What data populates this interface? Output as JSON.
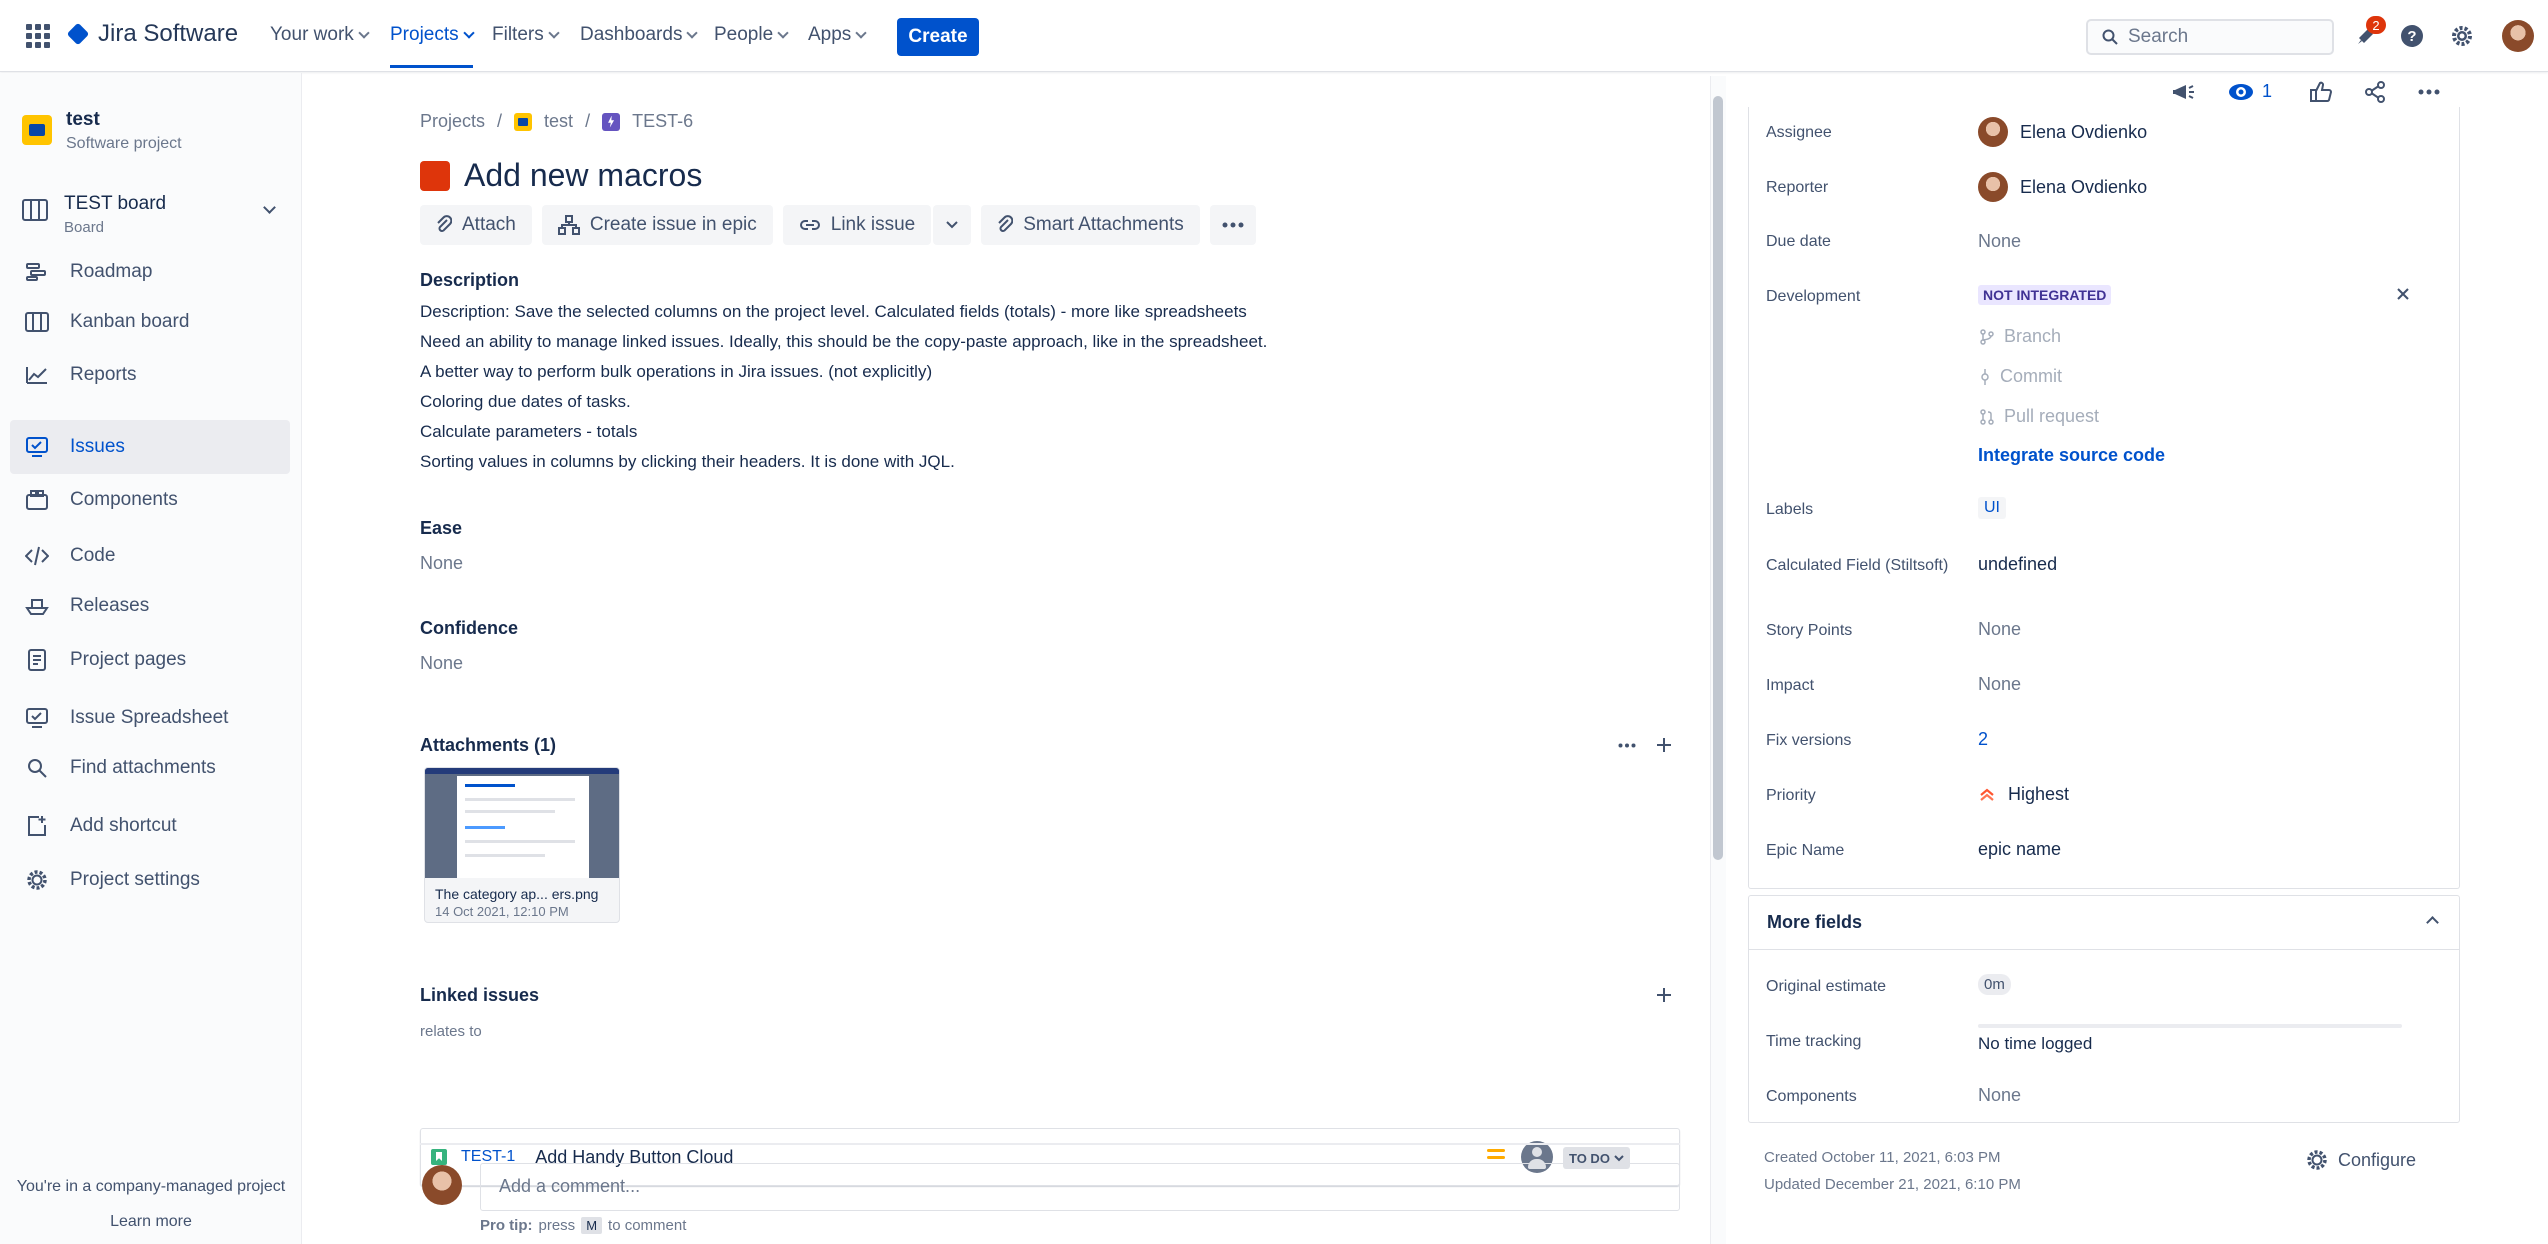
{
  "topnav": {
    "product": "Jira Software",
    "items": [
      {
        "label": "Your work"
      },
      {
        "label": "Projects"
      },
      {
        "label": "Filters"
      },
      {
        "label": "Dashboards"
      },
      {
        "label": "People"
      },
      {
        "label": "Apps"
      }
    ],
    "create_label": "Create",
    "search_placeholder": "Search",
    "notifications_count": "2"
  },
  "sidebar": {
    "project_name": "test",
    "project_type": "Software project",
    "board_name": "TEST board",
    "board_type": "Board",
    "items": [
      {
        "label": "Roadmap"
      },
      {
        "label": "Kanban board"
      },
      {
        "label": "Reports"
      },
      {
        "label": "Issues"
      },
      {
        "label": "Components"
      },
      {
        "label": "Code"
      },
      {
        "label": "Releases"
      },
      {
        "label": "Project pages"
      },
      {
        "label": "Issue Spreadsheet"
      },
      {
        "label": "Find attachments"
      },
      {
        "label": "Add shortcut"
      },
      {
        "label": "Project settings"
      }
    ],
    "footer_text": "You're in a company-managed project",
    "learn_more": "Learn more"
  },
  "breadcrumb": {
    "projects": "Projects",
    "project": "test",
    "issue_key": "TEST-6"
  },
  "issue": {
    "title": "Add new macros",
    "toolbar": {
      "attach": "Attach",
      "create_in_epic": "Create issue in epic",
      "link_issue": "Link issue",
      "smart_attachments": "Smart Attachments"
    },
    "description_heading": "Description",
    "description_lines": [
      "Description: Save the selected columns on the project level. Calculated fields (totals) - more like spreadsheets",
      "Need an ability to manage linked issues. Ideally, this should be the copy-paste approach, like in the spreadsheet.",
      "A better way to perform bulk operations in Jira issues. (not explicitly)",
      "Coloring due dates of tasks.",
      "Calculate parameters - totals",
      "Sorting values in columns by clicking their headers. It is done with JQL."
    ],
    "ease_heading": "Ease",
    "ease_value": "None",
    "confidence_heading": "Confidence",
    "confidence_value": "None",
    "attachments_heading": "Attachments (1)",
    "attachment": {
      "name": "The category ap... ers.png",
      "date": "14 Oct 2021, 12:10 PM"
    },
    "linked_heading": "Linked issues",
    "linked_relation": "relates to",
    "linked_issue": {
      "key": "TEST-1",
      "summary": "Add Handy Button Cloud",
      "status": "TO DO"
    },
    "comment_placeholder": "Add a comment...",
    "pro_tip_prefix": "Pro tip:",
    "pro_tip_press": "press",
    "pro_tip_key": "M",
    "pro_tip_suffix": "to comment"
  },
  "details": {
    "watchers": "1",
    "assignee_label": "Assignee",
    "assignee": "Elena Ovdienko",
    "reporter_label": "Reporter",
    "reporter": "Elena Ovdienko",
    "due_label": "Due date",
    "due": "None",
    "development_label": "Development",
    "development_status": "NOT INTEGRATED",
    "branch": "Branch",
    "commit": "Commit",
    "pull_request": "Pull request",
    "integrate": "Integrate source code",
    "labels_label": "Labels",
    "labels_value": "UI",
    "calc_label": "Calculated Field (Stiltsoft)",
    "calc_value": "undefined",
    "story_points_label": "Story Points",
    "story_points": "None",
    "impact_label": "Impact",
    "impact": "None",
    "fix_versions_label": "Fix versions",
    "fix_versions": "2",
    "priority_label": "Priority",
    "priority": "Highest",
    "epic_name_label": "Epic Name",
    "epic_name": "epic name",
    "more_fields": "More fields",
    "original_estimate_label": "Original estimate",
    "original_estimate": "0m",
    "time_tracking_label": "Time tracking",
    "time_tracking": "No time logged",
    "components_label": "Components",
    "components": "None",
    "created": "Created October 11, 2021, 6:03 PM",
    "updated": "Updated December 21, 2021, 6:10 PM",
    "configure": "Configure"
  },
  "colors": {
    "brand": "#0052cc",
    "epic_type": "#de350b",
    "story_type": "#36b37e",
    "priority_highest": "#ff5630"
  }
}
